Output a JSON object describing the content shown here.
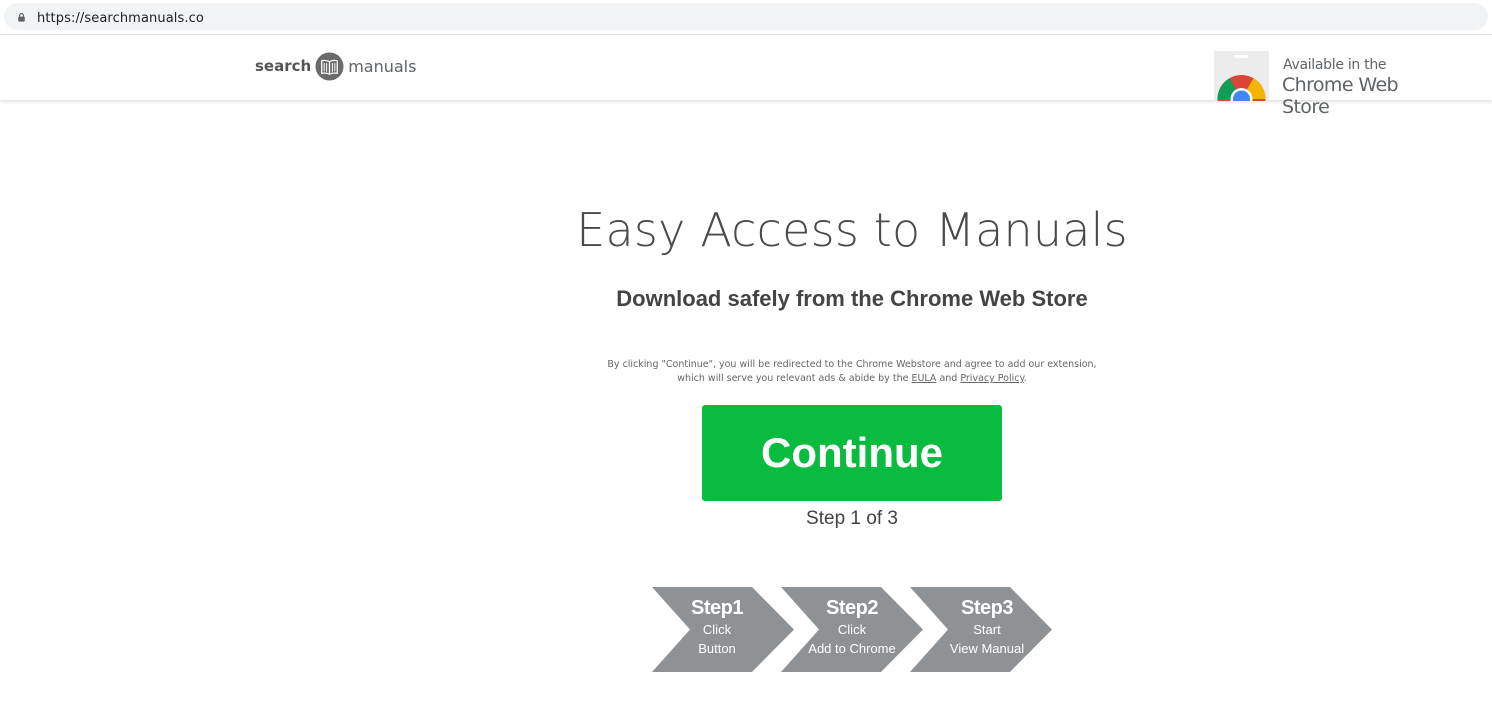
{
  "browser": {
    "url": "https://searchmanuals.co"
  },
  "header": {
    "logo_left": "search",
    "logo_right": "manuals",
    "store_badge_small": "Available in the",
    "store_badge_big": "Chrome Web Store"
  },
  "main": {
    "headline": "Easy Access to Manuals",
    "subline": "Download safely from the Chrome Web Store",
    "disclaimer_before": "By clicking \"Continue\", you will be redirected to the Chrome Webstore and agree to add our extension, which will serve you relevant ads & abide by the ",
    "eula_link": "EULA",
    "disclaimer_and": " and ",
    "privacy_link": "Privacy Policy",
    "disclaimer_end": ".",
    "continue_label": "Continue",
    "step_indicator": "Step 1 of 3"
  },
  "steps": [
    {
      "title": "Step1",
      "line1": "Click",
      "line2": "Button"
    },
    {
      "title": "Step2",
      "line1": "Click",
      "line2": "Add to Chrome"
    },
    {
      "title": "Step3",
      "line1": "Start",
      "line2": "View Manual"
    }
  ],
  "colors": {
    "continue_green": "#09bb3f",
    "step_gray": "#8f9294",
    "text_dark": "#4a4a4a"
  }
}
